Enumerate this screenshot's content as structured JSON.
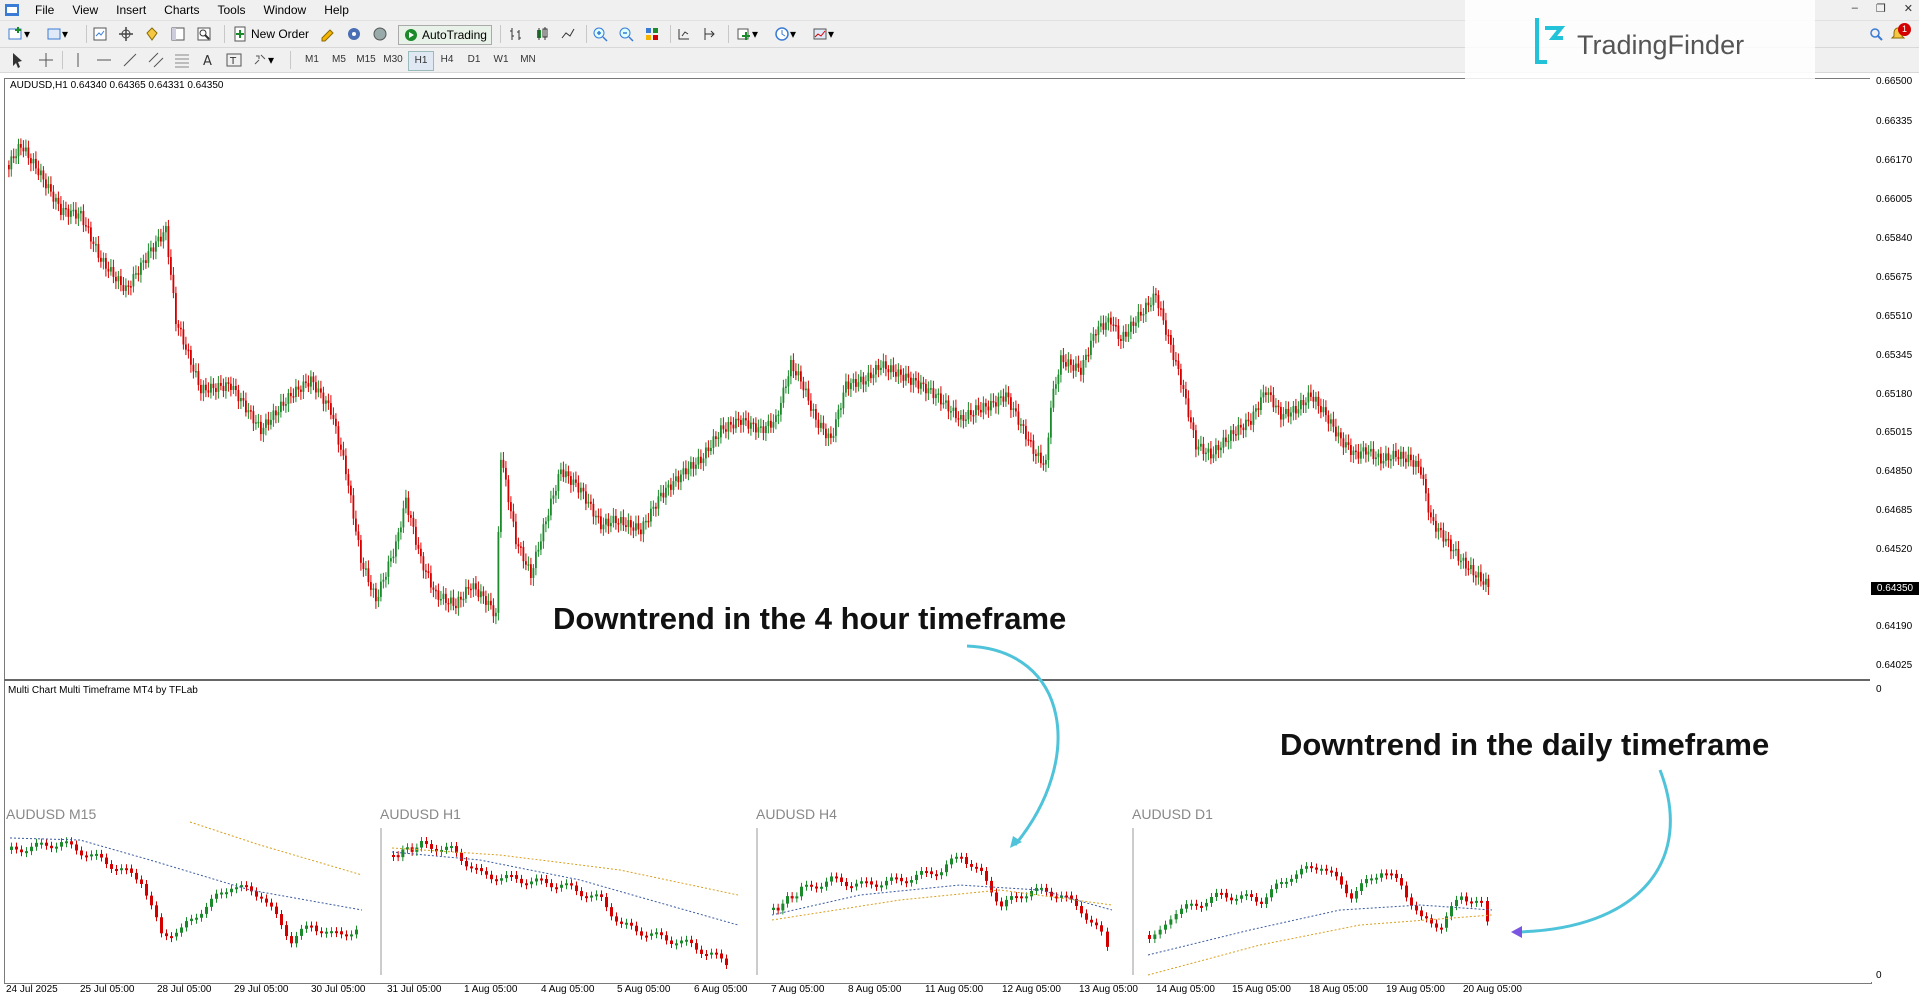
{
  "menu": {
    "items": [
      "File",
      "View",
      "Insert",
      "Charts",
      "Tools",
      "Window",
      "Help"
    ]
  },
  "toolbar": {
    "new_order_label": "New Order",
    "autotrading_label": "AutoTrading",
    "timeframes": [
      "M1",
      "M5",
      "M15",
      "M30",
      "H1",
      "H4",
      "D1",
      "W1",
      "MN"
    ],
    "active_timeframe": "H1"
  },
  "notifications": {
    "count": "1"
  },
  "brand": {
    "name": "TradingFinder",
    "color": "#22c3d8"
  },
  "chart": {
    "info": "AUDUSD,H1  0.64340 0.64365 0.64331 0.64350",
    "symbol": "AUDUSD",
    "period": "H1",
    "current_price": "0.64350",
    "price_labels": [
      "0.66500",
      "0.66335",
      "0.66170",
      "0.66005",
      "0.65840",
      "0.65675",
      "0.65510",
      "0.65345",
      "0.65180",
      "0.65015",
      "0.64850",
      "0.64685",
      "0.64520",
      "0.64190",
      "0.64025"
    ],
    "bull_color": "#1a8a2a",
    "bear_color": "#d40000"
  },
  "indicator": {
    "name": "Multi Chart Multi Timeframe MT4 by TFLab",
    "scale_top": "0",
    "scale_bottom": "0",
    "panels": [
      {
        "label": "AUDUSD M15"
      },
      {
        "label": "AUDUSD H1"
      },
      {
        "label": "AUDUSD H4"
      },
      {
        "label": "AUDUSD D1"
      }
    ]
  },
  "time_labels": [
    "24 Jul 2025",
    "25 Jul 05:00",
    "28 Jul 05:00",
    "29 Jul 05:00",
    "30 Jul 05:00",
    "31 Jul 05:00",
    "1 Aug 05:00",
    "4 Aug 05:00",
    "5 Aug 05:00",
    "6 Aug 05:00",
    "7 Aug 05:00",
    "8 Aug 05:00",
    "11 Aug 05:00",
    "12 Aug 05:00",
    "13 Aug 05:00",
    "14 Aug 05:00",
    "15 Aug 05:00",
    "18 Aug 05:00",
    "19 Aug 05:00",
    "20 Aug 05:00"
  ],
  "annotations": {
    "four_hour": "Downtrend in the 4 hour timeframe",
    "daily": "Downtrend in the daily timeframe",
    "arrow_color": "#4fc3d9"
  }
}
